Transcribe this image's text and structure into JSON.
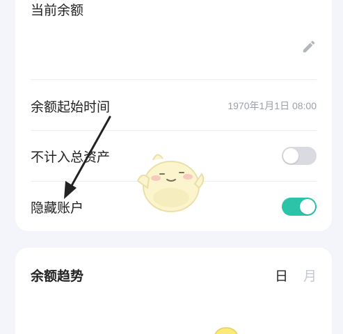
{
  "balance_section": {
    "label": "当前余额"
  },
  "settings": {
    "start_time": {
      "label": "余额起始时间",
      "value": "1970年1月1日 08:00"
    },
    "exclude_total": {
      "label": "不计入总资产",
      "enabled": false
    },
    "hide_account": {
      "label": "隐藏账户",
      "enabled": true
    }
  },
  "trend": {
    "title": "余额趋势",
    "tabs": [
      {
        "label": "日",
        "active": true
      },
      {
        "label": "月",
        "active": false
      }
    ]
  },
  "colors": {
    "accent": "#2cc4a8",
    "background": "#f3f5fa",
    "toggle_off": "#d9dbe0"
  }
}
